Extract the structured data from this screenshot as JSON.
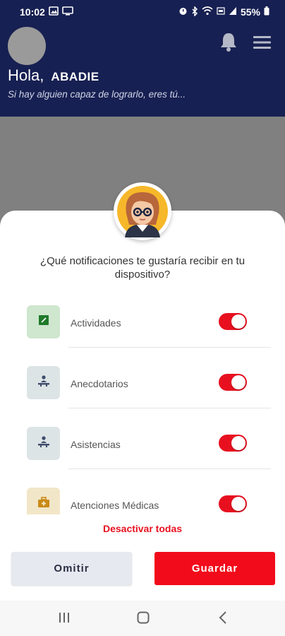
{
  "status_bar": {
    "time": "10:02",
    "battery": "55%",
    "icons_left": [
      "image-icon",
      "screen-icon"
    ],
    "icons_right": [
      "alarm-icon",
      "bluetooth-icon",
      "wifi-icon",
      "volte-icon",
      "signal-icon",
      "battery-icon"
    ]
  },
  "header": {
    "greeting": "Hola,",
    "user_name": "ABADIE",
    "slogan": "Si hay alguien capaz de lograrlo, eres tú...",
    "background_color": "#172052"
  },
  "dialog": {
    "question": "¿Qué notificaciones te gustaría recibir en tu dispositivo?",
    "items": [
      {
        "label": "Actividades",
        "icon": "activity-icon",
        "tile_color": "#cfe6cf",
        "enabled": true
      },
      {
        "label": "Anecdotarios",
        "icon": "person-desk-icon",
        "tile_color": "#dde4e6",
        "enabled": true
      },
      {
        "label": "Asistencias",
        "icon": "person-desk-icon",
        "tile_color": "#dde4e6",
        "enabled": true
      },
      {
        "label": "Atenciones Médicas",
        "icon": "medical-kit-icon",
        "tile_color": "#f2e6c8",
        "enabled": true
      }
    ],
    "deactivate_all": "Desactivar todas",
    "skip_label": "Omitir",
    "save_label": "Guardar",
    "accent_color": "#e8101f"
  },
  "nav_bar": {
    "items": [
      "recents-icon",
      "home-icon",
      "back-icon"
    ]
  }
}
